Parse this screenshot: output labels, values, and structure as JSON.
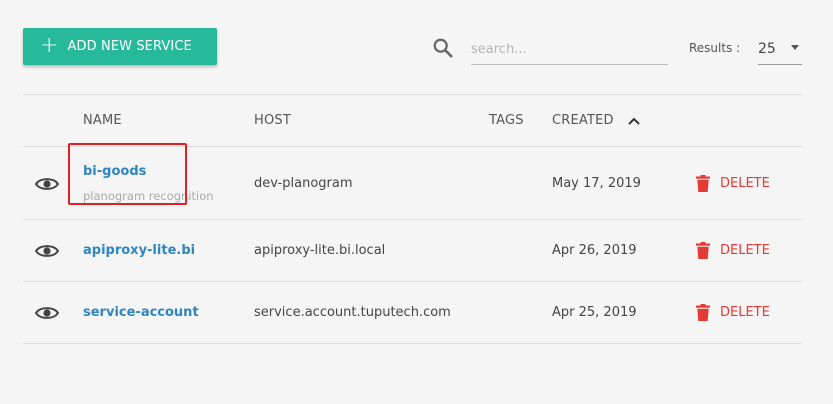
{
  "toolbar": {
    "add_label": "ADD NEW SERVICE",
    "search_placeholder": "search...",
    "results_label": "Results :",
    "results_value": "25"
  },
  "table": {
    "headers": {
      "name": "NAME",
      "host": "HOST",
      "tags": "TAGS",
      "created": "CREATED"
    },
    "rows": [
      {
        "name": "bi-goods",
        "description": "planogram recognition",
        "host": "dev-planogram",
        "tags": "",
        "created": "May 17, 2019",
        "delete_label": "DELETE"
      },
      {
        "name": "apiproxy-lite.bi",
        "description": "",
        "host": "apiproxy-lite.bi.local",
        "tags": "",
        "created": "Apr 26, 2019",
        "delete_label": "DELETE"
      },
      {
        "name": "service-account",
        "description": "",
        "host": "service.account.tuputech.com",
        "tags": "",
        "created": "Apr 25, 2019",
        "delete_label": "DELETE"
      }
    ]
  },
  "colors": {
    "accent": "#26b99a",
    "link": "#2e86c1",
    "danger": "#e53935",
    "highlight": "#e41e26"
  }
}
